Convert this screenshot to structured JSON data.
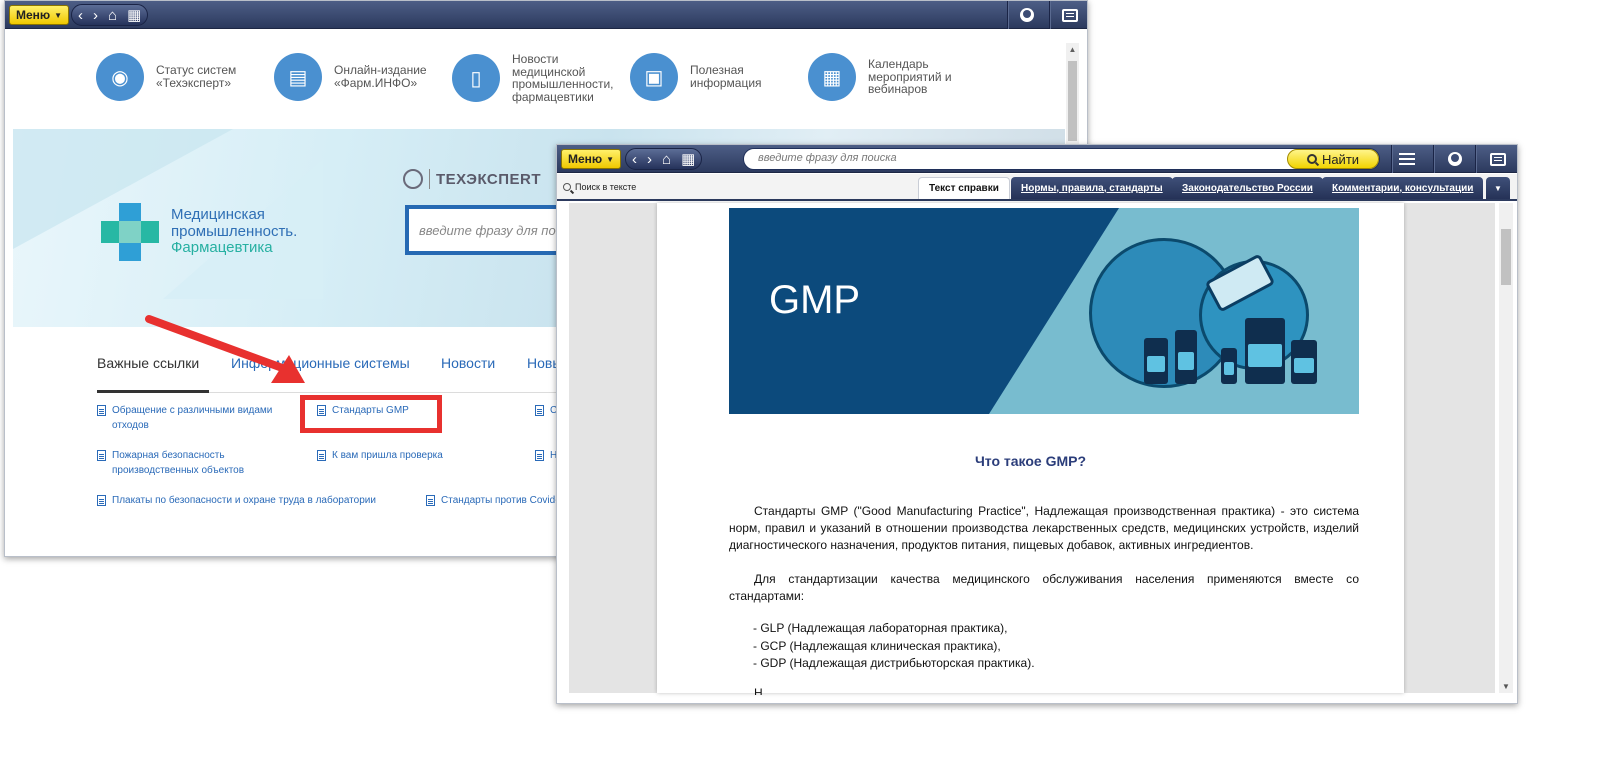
{
  "back_window": {
    "toolbar": {
      "menu_label": "Меню"
    },
    "quick_links": [
      {
        "icon": "status-icon",
        "label": "Статус систем «Техэксперт»"
      },
      {
        "icon": "monitor-icon",
        "label": "Онлайн-издание «Фарм.ИНФО»"
      },
      {
        "icon": "news-doc-icon",
        "label": "Новости медицинской промышленности, фармацевтики"
      },
      {
        "icon": "info-doc-icon",
        "label": "Полезная информация"
      },
      {
        "icon": "calendar-icon",
        "label": "Календарь мероприятий и вебинаров"
      }
    ],
    "banner": {
      "logo_line1": "Медицинская",
      "logo_line2": "промышленность.",
      "logo_line3": "Фармацевтика",
      "brand": "ТЕХЭКСПЕRТ",
      "search_placeholder": "введите фразу для поиск"
    },
    "tabs": [
      "Важные ссылки",
      "Информационные системы",
      "Новости",
      "Новы"
    ],
    "links": [
      "Обращение с различными видами отходов",
      "Стандарты GMP",
      "С",
      "Пожарная безопасность производственных объектов",
      "К вам пришла проверка",
      "Н",
      "Плакаты по безопасности и охране труда в лаборатории",
      "Стандарты против Covid-"
    ]
  },
  "front_window": {
    "toolbar": {
      "menu_label": "Меню",
      "search_placeholder": "введите фразу для поиска",
      "find_label": "Найти"
    },
    "search_in_text": "Поиск в тексте",
    "tabs": [
      {
        "label": "Текст справки",
        "active": true
      },
      {
        "label": "Нормы, правила, стандарты",
        "active": false
      },
      {
        "label": "Законодательство России",
        "active": false
      },
      {
        "label": "Комментарии, консультации",
        "active": false
      }
    ],
    "document": {
      "banner_title": "GMP",
      "heading": "Что такое GMP?",
      "para1": "Стандарты GMP (\"Good Manufacturing Practice\", Надлежащая производственная практика) - это система норм, правил и указаний в отношении производства лекарственных средств, медицинских устройств, изделий диагностического назначения, продуктов питания, пищевых добавок, активных ингредиентов.",
      "para2": "Для стандартизации качества медицинского обслуживания населения применяются вместе со стандартами:",
      "list": [
        "- GLP (Надлежащая лабораторная практика),",
        "- GCP (Надлежащая клиническая практика),",
        "- GDP (Надлежащая дистрибьюторская практика)."
      ],
      "para3_partial": "Н"
    }
  },
  "colors": {
    "toolbar": "#2c3a5e",
    "accent_yellow": "#f0c800",
    "link_blue": "#2a6ab8",
    "highlight_red": "#e8312f",
    "gmp_dark": "#0c4a7c",
    "gmp_light": "#78bccf"
  }
}
